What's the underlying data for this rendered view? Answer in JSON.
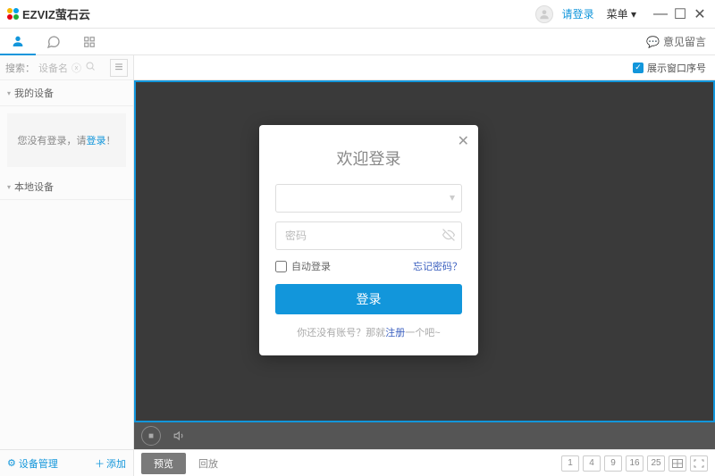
{
  "topbar": {
    "brand": "EZVIZ萤石云",
    "login_link": "请登录",
    "menu": "菜单"
  },
  "subbar": {
    "feedback": "意见留言"
  },
  "sidebar": {
    "search_label": "搜索：",
    "search_placeholder": "设备名",
    "section_my_devices": "我的设备",
    "section_local_devices": "本地设备",
    "login_prompt_prefix": "您没有登录，请",
    "login_prompt_link": "登录",
    "login_prompt_suffix": "！",
    "device_mgmt": "设备管理",
    "add": "添加"
  },
  "main": {
    "show_window_index": "展示窗口序号",
    "tab_preview": "预览",
    "tab_playback": "回放",
    "layout_options": [
      "1",
      "4",
      "9",
      "16",
      "25"
    ]
  },
  "modal": {
    "title": "欢迎登录",
    "username_placeholder": "",
    "password_placeholder": "密码",
    "auto_login": "自动登录",
    "forgot": "忘记密码？",
    "login_btn": "登录",
    "register_prefix": "你还没有账号？那就",
    "register_link": "注册",
    "register_suffix": "一个吧~"
  }
}
